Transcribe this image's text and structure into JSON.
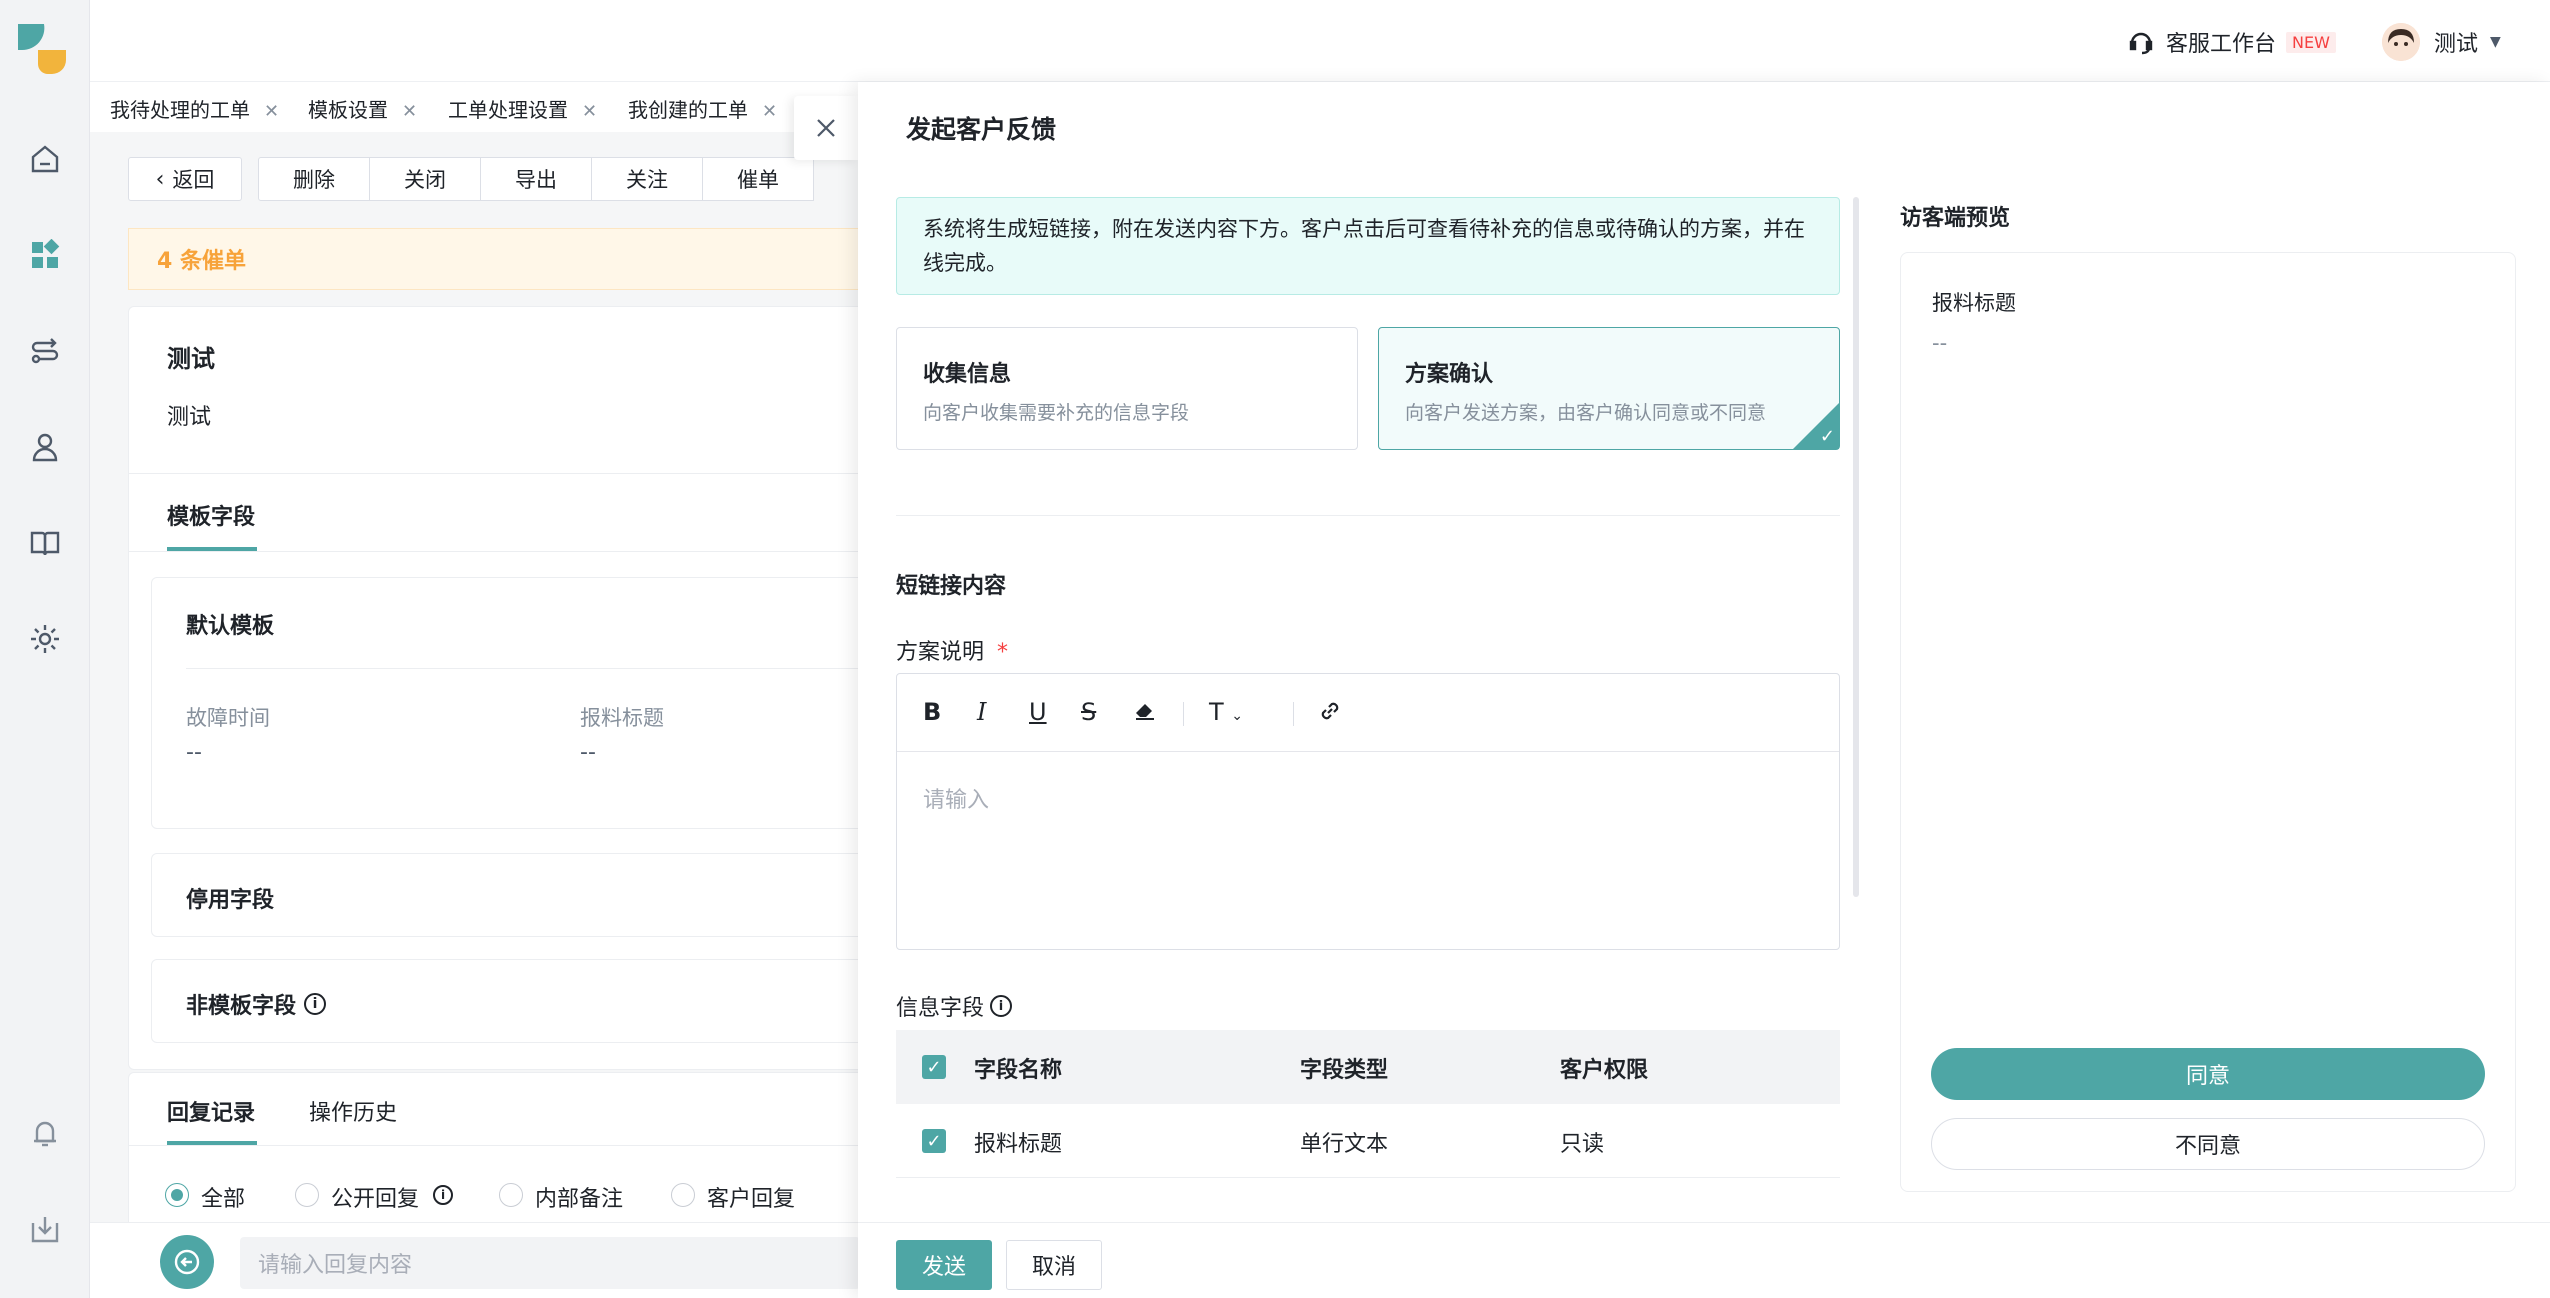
{
  "topbar": {
    "workspace_label": "客服工作台",
    "new_badge": "NEW",
    "user_name": "测试"
  },
  "tabs": [
    {
      "label": "我待处理的工单"
    },
    {
      "label": "模板设置"
    },
    {
      "label": "工单处理设置"
    },
    {
      "label": "我创建的工单"
    }
  ],
  "toolbar": {
    "back": "返回",
    "delete": "删除",
    "close": "关闭",
    "export": "导出",
    "follow": "关注",
    "urge": "催单"
  },
  "urge_banner": "4 条催单",
  "ticket": {
    "title": "测试",
    "description": "测试",
    "tab_template_fields": "模板字段",
    "default_template": "默认模板",
    "field1_label": "故障时间",
    "field1_value": "--",
    "field2_label": "报料标题",
    "field2_value": "--",
    "disabled_fields": "停用字段",
    "non_template_fields": "非模板字段"
  },
  "records": {
    "tab_reply": "回复记录",
    "tab_history": "操作历史",
    "filters": [
      "全部",
      "公开回复",
      "内部备注",
      "客户回复"
    ],
    "reply_placeholder": "请输入回复内容"
  },
  "drawer": {
    "title": "发起客户反馈",
    "hint": "系统将生成短链接，附在发送内容下方。客户点击后可查看待补充的信息或待确认的方案，并在线完成。",
    "options": [
      {
        "title": "收集信息",
        "desc": "向客户收集需要补充的信息字段"
      },
      {
        "title": "方案确认",
        "desc": "向客户发送方案，由客户确认同意或不同意"
      }
    ],
    "section_title": "短链接内容",
    "plan_label": "方案说明",
    "required_mark": "*",
    "editor_placeholder": "请输入",
    "info_fields_label": "信息字段",
    "table_headers": [
      "字段名称",
      "字段类型",
      "客户权限"
    ],
    "table_rows": [
      {
        "name": "报料标题",
        "type": "单行文本",
        "permission": "只读"
      }
    ],
    "send": "发送",
    "cancel": "取消"
  },
  "preview": {
    "title": "访客端预览",
    "field_label": "报料标题",
    "field_value": "--",
    "agree": "同意",
    "disagree": "不同意"
  },
  "colors": {
    "accent": "#4ea6a5",
    "warning": "#f7a33a",
    "required": "#f53f3f"
  }
}
